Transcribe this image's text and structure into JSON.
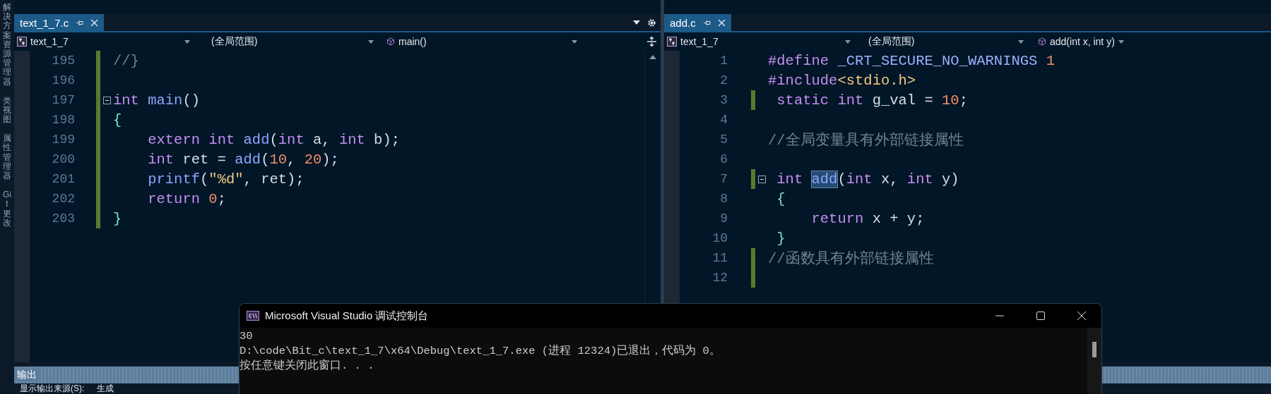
{
  "sidebar": {
    "tabs": [
      {
        "label": "解决方案资源管理器"
      },
      {
        "label": "类视图"
      },
      {
        "label": "属性管理器"
      },
      {
        "label": "Git 更改"
      }
    ]
  },
  "editors": [
    {
      "tab": {
        "label": "text_1_7.c",
        "selected": true
      },
      "nav": {
        "project": "text_1_7",
        "scope": "(全局范围)",
        "member": "main()"
      },
      "lines": [
        {
          "number": "195",
          "modified": true,
          "tokens": [
            {
              "kind": "comment",
              "text": "//}"
            }
          ]
        },
        {
          "number": "196",
          "modified": true
        },
        {
          "number": "197",
          "modified": true,
          "foldable": true,
          "tokens": [
            {
              "kind": "keyword",
              "text": "int"
            },
            {
              "kind": "function",
              "text": " main"
            },
            {
              "kind": "plain",
              "text": "()"
            }
          ]
        },
        {
          "number": "198",
          "modified": true,
          "tokens": [
            {
              "kind": "brace",
              "text": "{"
            }
          ]
        },
        {
          "number": "199",
          "modified": true,
          "tokens": [
            {
              "kind": "keyword",
              "text": "    extern"
            },
            {
              "kind": "keyword",
              "text": " int"
            },
            {
              "kind": "function",
              "text": " add"
            },
            {
              "kind": "plain",
              "text": "("
            },
            {
              "kind": "keyword",
              "text": "int"
            },
            {
              "kind": "plain",
              "text": " a, "
            },
            {
              "kind": "keyword",
              "text": "int"
            },
            {
              "kind": "plain",
              "text": " b);"
            }
          ]
        },
        {
          "number": "200",
          "modified": true,
          "tokens": [
            {
              "kind": "keyword",
              "text": "    int"
            },
            {
              "kind": "plain",
              "text": " ret = "
            },
            {
              "kind": "function",
              "text": "add"
            },
            {
              "kind": "plain",
              "text": "("
            },
            {
              "kind": "number",
              "text": "10"
            },
            {
              "kind": "plain",
              "text": ", "
            },
            {
              "kind": "number",
              "text": "20"
            },
            {
              "kind": "plain",
              "text": ");"
            }
          ]
        },
        {
          "number": "201",
          "modified": true,
          "tokens": [
            {
              "kind": "function",
              "text": "    printf"
            },
            {
              "kind": "plain",
              "text": "("
            },
            {
              "kind": "string",
              "text": "\"%d\""
            },
            {
              "kind": "plain",
              "text": ", ret);"
            }
          ]
        },
        {
          "number": "202",
          "modified": true,
          "tokens": [
            {
              "kind": "keyword",
              "text": "    return"
            },
            {
              "kind": "number",
              "text": " 0"
            },
            {
              "kind": "plain",
              "text": ";"
            }
          ]
        },
        {
          "number": "203",
          "modified": true,
          "tokens": [
            {
              "kind": "brace",
              "text": "}"
            }
          ]
        }
      ]
    },
    {
      "tab": {
        "label": "add.c",
        "selected": true
      },
      "nav": {
        "project": "text_1_7",
        "scope": "(全局范围)",
        "member": "add(int x, int y)"
      },
      "lines": [
        {
          "number": "1",
          "modified": false,
          "tokens": [
            {
              "kind": "keyword",
              "text": "#define"
            },
            {
              "kind": "macro",
              "text": " _CRT_SECURE_NO_WARNINGS"
            },
            {
              "kind": "number",
              "text": " 1"
            }
          ]
        },
        {
          "number": "2",
          "modified": false,
          "tokens": [
            {
              "kind": "keyword",
              "text": "#include"
            },
            {
              "kind": "string",
              "text": "<stdio.h>"
            }
          ]
        },
        {
          "number": "3",
          "modified": true,
          "tokens": [
            {
              "kind": "keyword",
              "text": " static"
            },
            {
              "kind": "keyword",
              "text": " int"
            },
            {
              "kind": "plain",
              "text": " g_val = "
            },
            {
              "kind": "number",
              "text": "10"
            },
            {
              "kind": "plain",
              "text": ";"
            }
          ]
        },
        {
          "number": "4",
          "modified": false
        },
        {
          "number": "5",
          "modified": false,
          "tokens": [
            {
              "kind": "comment",
              "text": "//全局变量具有外部链接属性"
            }
          ]
        },
        {
          "number": "6",
          "modified": false
        },
        {
          "number": "7",
          "modified": true,
          "foldable": true,
          "tokens": [
            {
              "kind": "keyword",
              "text": " int "
            },
            {
              "kind": "highlight",
              "text": "add"
            },
            {
              "kind": "plain",
              "text": "("
            },
            {
              "kind": "keyword",
              "text": "int"
            },
            {
              "kind": "plain",
              "text": " x, "
            },
            {
              "kind": "keyword",
              "text": "int"
            },
            {
              "kind": "plain",
              "text": " y)"
            }
          ]
        },
        {
          "number": "8",
          "modified": false,
          "tokens": [
            {
              "kind": "brace",
              "text": " {"
            }
          ]
        },
        {
          "number": "9",
          "modified": false,
          "tokens": [
            {
              "kind": "keyword",
              "text": "     return"
            },
            {
              "kind": "plain",
              "text": " x + y;"
            }
          ]
        },
        {
          "number": "10",
          "modified": false,
          "tokens": [
            {
              "kind": "brace",
              "text": " }"
            }
          ]
        },
        {
          "number": "11",
          "modified": true,
          "tokens": [
            {
              "kind": "comment",
              "text": "//函数具有外部链接属性"
            }
          ]
        },
        {
          "number": "12",
          "modified": true
        }
      ]
    }
  ],
  "output_panel": {
    "title": "输出",
    "source_label": "显示输出来源(S):",
    "source_value": "生成"
  },
  "console": {
    "title": "Microsoft Visual Studio 调试控制台",
    "lines": [
      "30",
      "D:\\code\\Bit_c\\text_1_7\\x64\\Debug\\text_1_7.exe (进程 12324)已退出，代码为 0。",
      "按任意键关闭此窗口. . ."
    ]
  }
}
